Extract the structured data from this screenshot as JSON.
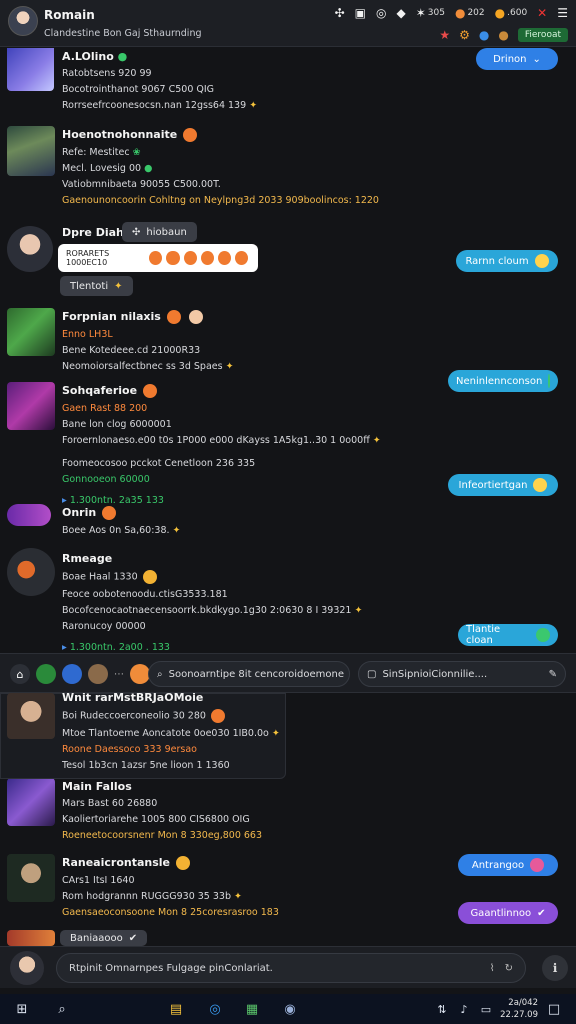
{
  "header": {
    "title": "Romain",
    "subtitle": "Clandestine Bon Gaj Sthaurnding",
    "icons": [
      "pin-icon",
      "square-icon",
      "chat-icon",
      "shield-icon"
    ],
    "stats": [
      {
        "icon": "fire-icon",
        "value": "305"
      },
      {
        "icon": "coin-icon",
        "value": "202"
      },
      {
        "icon": "bag-icon",
        "value": ".600"
      }
    ],
    "status_label": "Fierooat"
  },
  "messages": [
    {
      "name": "A.LOlino",
      "lines": [
        "Ratobtsens 920 99",
        "Bocotrointhanot 9067 C500 QIG",
        "Rorrseefrcoonesocsn.nan 12gss64 139"
      ],
      "button": "Drinon"
    },
    {
      "name": "Hoenotnohonnaite",
      "lines": [
        "Refe: Mestitec",
        "Mecl. Lovesig 00",
        "Vatiobmnibaeta 90055 C500.00T.",
        "Gaenounoncoorin Cohltng on Neylpng3d 2033 909boolincos: 1220"
      ]
    },
    {
      "name": "Dpre Diahe",
      "chip": "hiobaun",
      "bubble": "RORARETS 1000EC10",
      "chip2": "Tlentoti",
      "button": "Rarnn cloum"
    },
    {
      "name": "Forpnian nilaxis",
      "lines": [
        "Enno LH3L",
        "Bene Kotedeee.cd 21000R33",
        "Neomoiorsalfectbnec ss 3d Spaes"
      ]
    },
    {
      "name": "Sohqaferioe",
      "lines": [
        "Gaen Rast 88 200",
        "Bane lon clog 6000001",
        "Foroernlonaeso.e00 t0s 1P000 e000 dKayss 1A5kg1..30 1 0o00ff"
      ],
      "lines2": [
        "Foomeocosoo pcckot Cenetloon 236 335",
        "Gonnooeon 60000"
      ],
      "meta": "1.300ntn. 2a35 133",
      "button": "Neninlennconson",
      "button2": "Infeortiertgan"
    },
    {
      "name": "Onrin",
      "lines": [
        "Boee Aos 0n Sa,60:38."
      ]
    },
    {
      "name": "Rmeage",
      "lines": [
        "Boae Haal 1330",
        "Feoce oobotenoodu.ctisG3533.181",
        "Bocofcenocaotnaecensoorrk.bkdkygo.1g30 2:0630 8 I 39321",
        "Raronucoy 00000"
      ],
      "meta": "1.300ntn. 2a00 . 133",
      "button": "Tlantie cloan"
    },
    {
      "name": "Wnit rarMstBRJaOMoie",
      "lines": [
        "Boi Rudeccoerconeolio 30 280",
        "Mtoe Tlantoeme Aoncatote 0oe030 1IB0.0o",
        "Roone Daessoco 333 9ersao",
        "Tesol 1b3cn 1azsr 5ne lioon 1 1360"
      ]
    },
    {
      "name": "Main Fallos",
      "lines": [
        "Mars Bast 60 26880",
        "Kaoliertoriarehe 1005 800 CIS6800 OIG",
        "Roeneetocoorsnenr Mon 8 330eg,800 663"
      ]
    },
    {
      "name": "Raneaicrontansle",
      "lines": [
        "CArs1 ItsI 1640",
        "Rom hodgrannn RUGGG930 35 33b",
        "Gaensaeoconsoone Mon 8 25coresrasroo 183"
      ],
      "button": "Antrangoo",
      "button2": "Gaantlinnoo"
    },
    {
      "name": "Baniaaooo"
    }
  ],
  "searchbar": {
    "primary_placeholder": "Soonoarntipe 8it cencoroidoemone",
    "secondary_placeholder": "SinSipnioiCionnilie...."
  },
  "composer": {
    "placeholder": "Rtpinit Omnarnpes Fulgage pinConlariat."
  },
  "taskbar": {
    "time": "2a/042",
    "date": "22.27.09"
  },
  "colors": {
    "background": "#131417",
    "accent_blue": "#2f80e6",
    "accent_cyan": "#2aa6d9",
    "accent_purple": "#8a4fd8",
    "online_green": "#1e6a35"
  }
}
